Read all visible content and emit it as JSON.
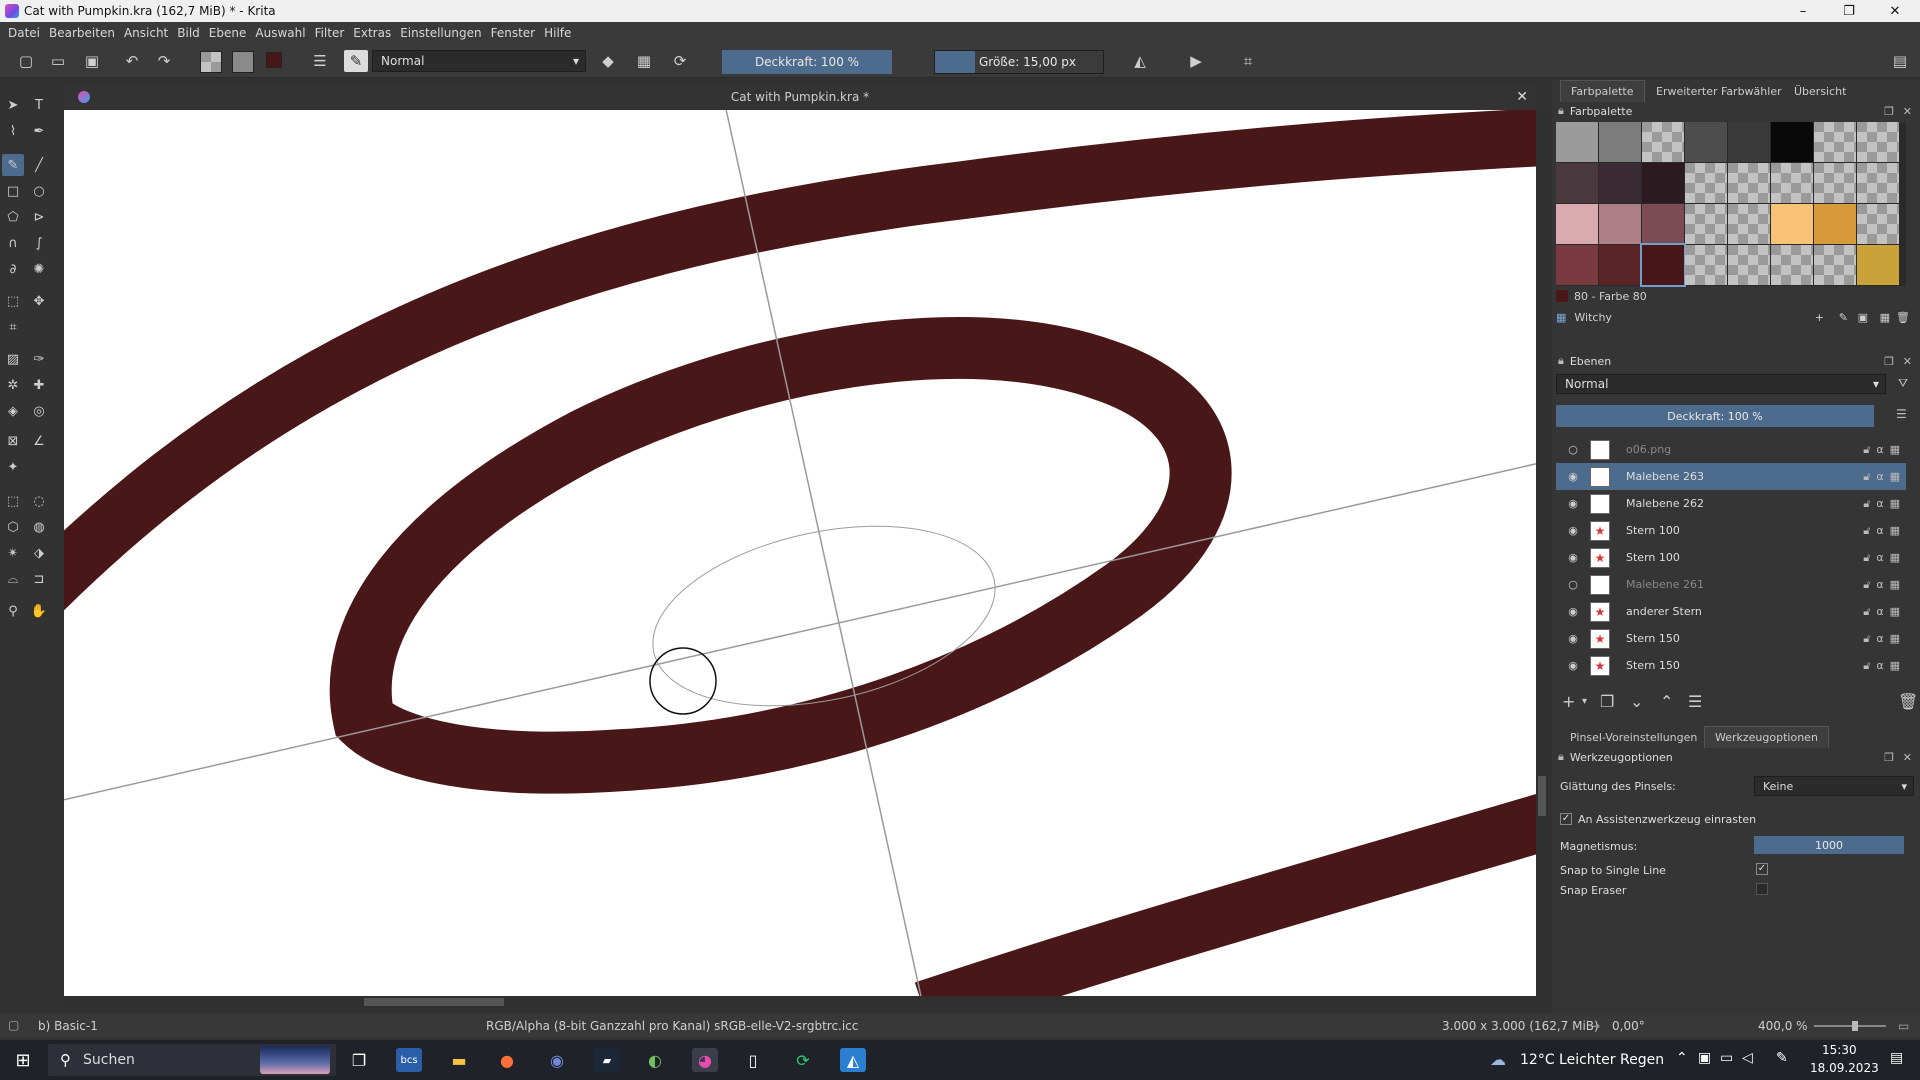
{
  "window": {
    "title": "Cat with Pumpkin.kra (162,7 MiB)  * - Krita",
    "minimize": "–",
    "maximize": "❐",
    "close": "✕"
  },
  "menu": [
    "Datei",
    "Bearbeiten",
    "Ansicht",
    "Bild",
    "Ebene",
    "Auswahl",
    "Filter",
    "Extras",
    "Einstellungen",
    "Fenster",
    "Hilfe"
  ],
  "toolbar": {
    "blend_mode": "Normal",
    "opacity_label": "Deckkraft: 100 %",
    "size_label": "Größe: 15,00 px",
    "fg_color": "#4a1719",
    "bg_color": "#f5a03b"
  },
  "document": {
    "tab_title": "Cat with Pumpkin.kra *",
    "stroke_color": "#4a1719"
  },
  "status": {
    "brush": "b) Basic-1",
    "color_profile": "RGB/Alpha (8-bit Ganzzahl pro Kanal)  sRGB-elle-V2-srgbtrc.icc",
    "image_size": "3.000 x 3.000 (162,7 MiB)",
    "rotation": "0,00°",
    "zoom": "400,0 %"
  },
  "dock": {
    "tabs": [
      "Farbpalette",
      "Erweiterter Farbwähler",
      "Übersicht"
    ],
    "palette_title": "Farbpalette",
    "palette_rows": [
      [
        "#9b9b9b",
        "#7c7c7c",
        "checker",
        "#4d4d4d",
        "#3a3a3a",
        "#090909",
        "checker",
        "checker"
      ],
      [
        "#4a3a40",
        "#3a2a33",
        "#2b1a20",
        "checker",
        "checker",
        "checker",
        "checker",
        "checker"
      ],
      [
        "#d9aab0",
        "#ae7f86",
        "#7c4c55",
        "checker",
        "checker",
        "#f8c377",
        "#d99a3b",
        "checker"
      ],
      [
        "#7a3b40",
        "#5b2528",
        "#4a1719",
        "checker",
        "checker",
        "checker",
        "checker",
        "#c9a23a"
      ]
    ],
    "selected_color": "80 - Farbe 80",
    "palette_name": "Witchy",
    "layers_title": "Ebenen",
    "layers_blend": "Normal",
    "layers_opacity": "Deckkraft:  100 %",
    "layers": [
      {
        "name": "o06.png",
        "visible": false,
        "selected": false
      },
      {
        "name": "Malebene 263",
        "visible": true,
        "selected": true
      },
      {
        "name": "Malebene 262",
        "visible": true,
        "selected": false
      },
      {
        "name": "Stern 100",
        "visible": true,
        "selected": false
      },
      {
        "name": "Stern 100",
        "visible": true,
        "selected": false
      },
      {
        "name": "Malebene 261",
        "visible": false,
        "selected": false
      },
      {
        "name": "anderer Stern",
        "visible": true,
        "selected": false
      },
      {
        "name": "Stern 150",
        "visible": true,
        "selected": false
      },
      {
        "name": "Stern 150",
        "visible": true,
        "selected": false
      }
    ],
    "bottom_tabs": [
      "Pinsel-Voreinstellungen",
      "Werkzeugoptionen"
    ],
    "tool_options_title": "Werkzeugoptionen",
    "smoothing_label": "Glättung des Pinsels:",
    "smoothing_value": "Keine",
    "snap_assist_label": "An Assistenzwerkzeug einrasten",
    "magnetism_label": "Magnetismus:",
    "magnetism_value": "1000",
    "snap_single_label": "Snap to Single Line",
    "snap_eraser_label": "Snap Eraser"
  },
  "taskbar": {
    "search_placeholder": "Suchen",
    "weather": "12°C  Leichter Regen",
    "time": "15:30",
    "date": "18.09.2023"
  }
}
